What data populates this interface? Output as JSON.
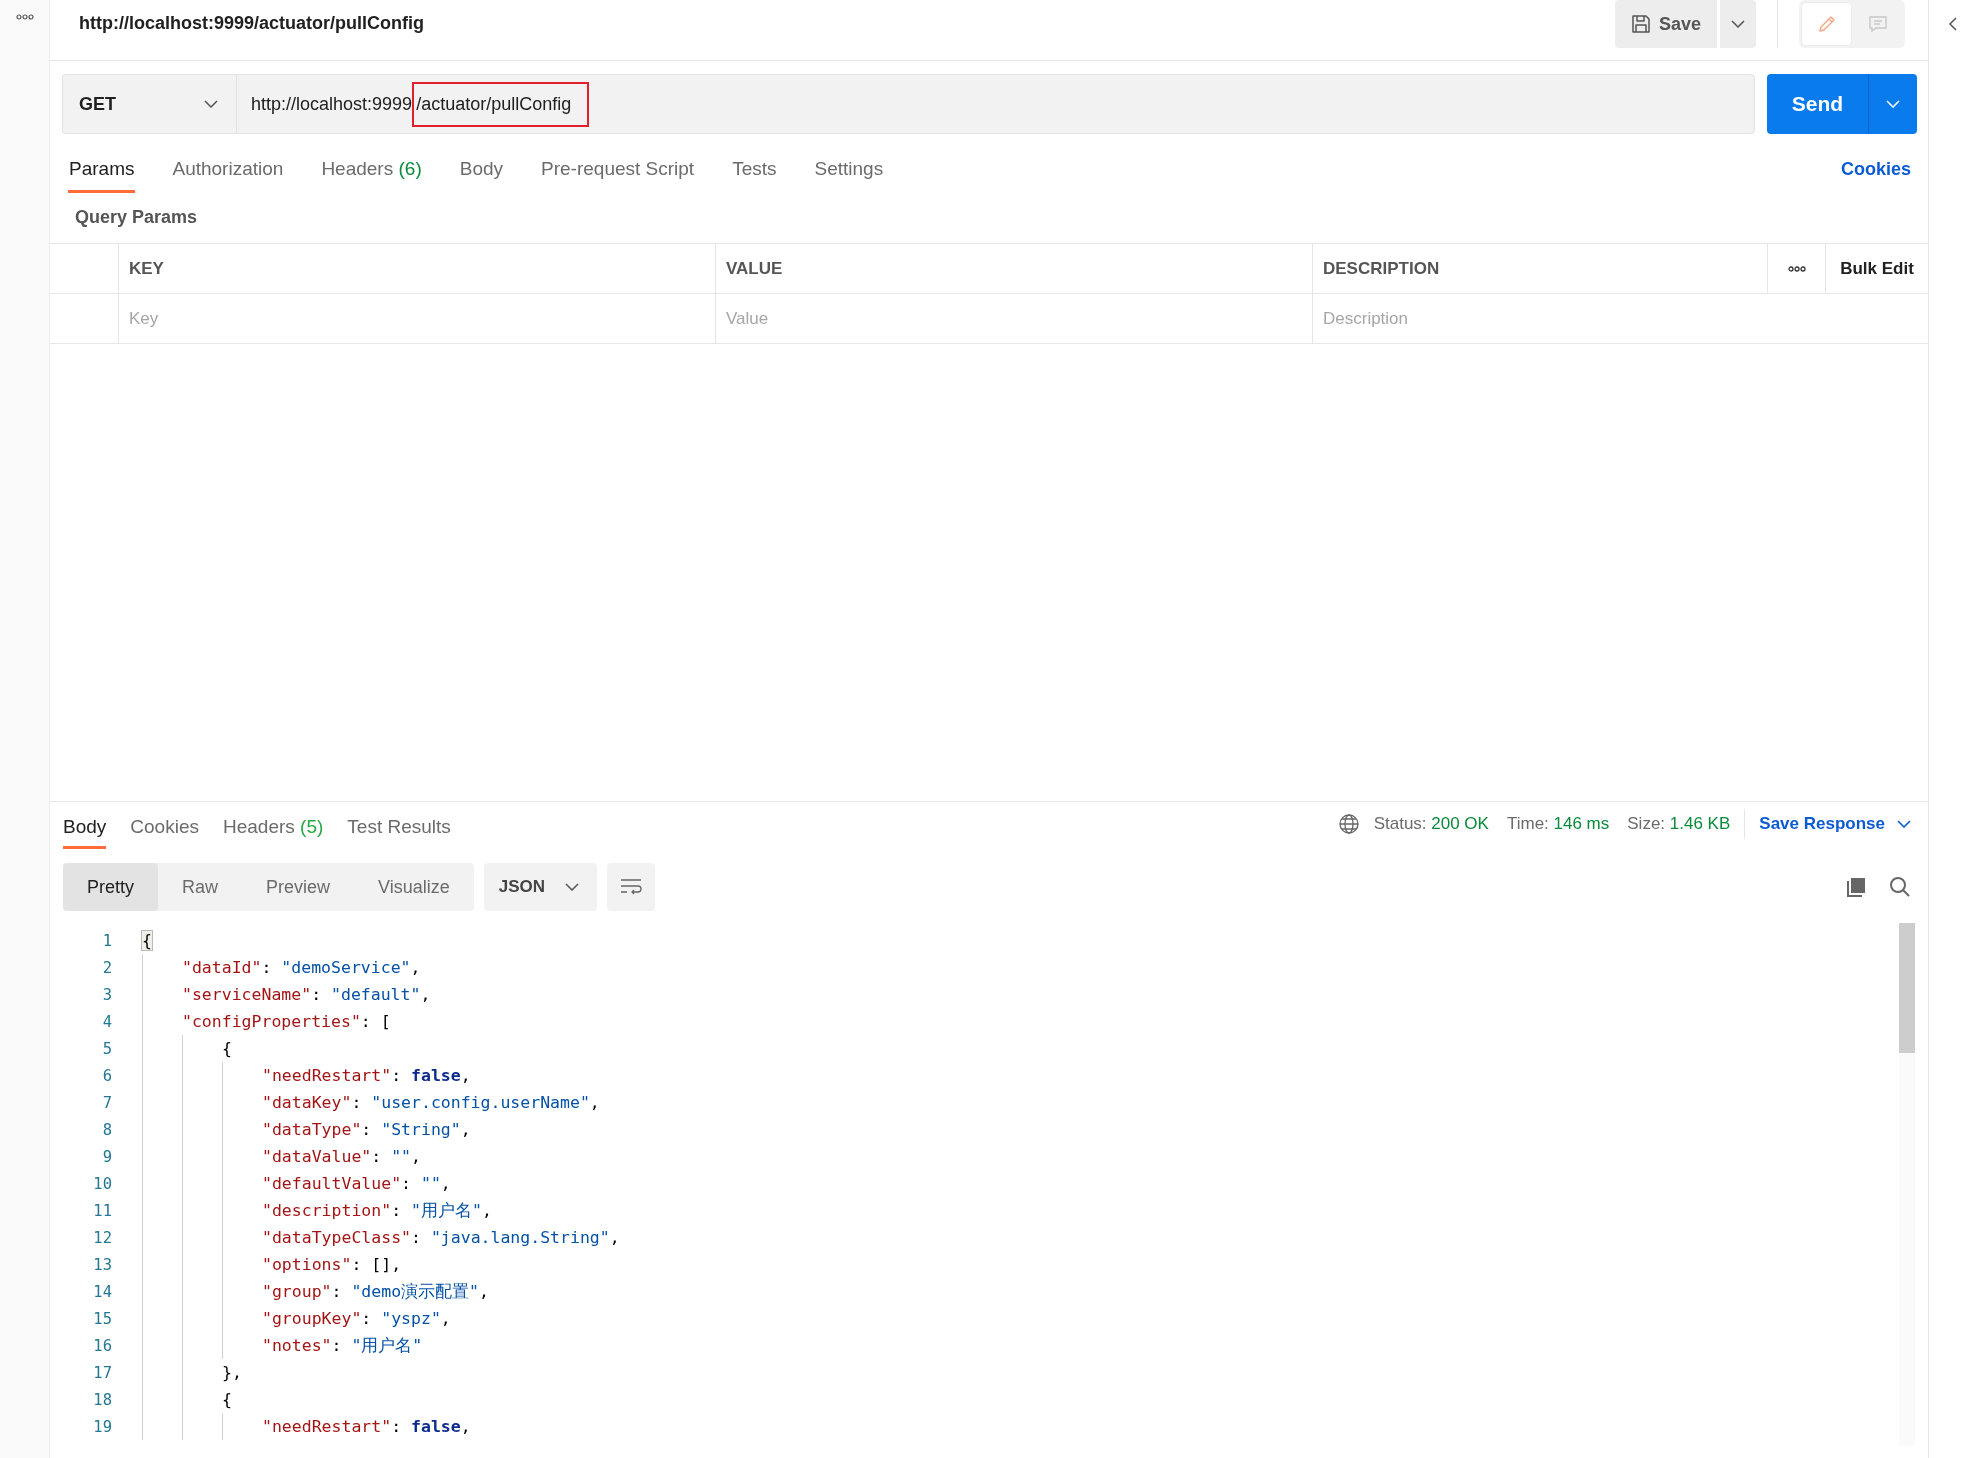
{
  "request_title": "http://localhost:9999/actuator/pullConfig",
  "save_button": {
    "label": "Save"
  },
  "mode_buttons": [
    {
      "kind": "edit",
      "selected": true
    },
    {
      "kind": "comment",
      "selected": false
    }
  ],
  "method": {
    "value": "GET"
  },
  "url_parts": [
    {
      "text": "http://localhost:9999",
      "highlighted": false
    },
    {
      "text": "/actuator/pullConfig",
      "highlighted": true
    }
  ],
  "send_button": {
    "label": "Send"
  },
  "request_tabs": [
    {
      "label": "Params",
      "selected": true
    },
    {
      "label": "Authorization",
      "selected": false
    },
    {
      "label": "Headers",
      "count": "(6)",
      "selected": false
    },
    {
      "label": "Body",
      "selected": false
    },
    {
      "label": "Pre-request Script",
      "selected": false
    },
    {
      "label": "Tests",
      "selected": false
    },
    {
      "label": "Settings",
      "selected": false
    }
  ],
  "cookies_link": "Cookies",
  "query_params": {
    "title": "Query Params",
    "columns": [
      "KEY",
      "VALUE",
      "DESCRIPTION"
    ],
    "bulk_edit": "Bulk Edit",
    "placeholders": [
      "Key",
      "Value",
      "Description"
    ]
  },
  "response_tabs": [
    {
      "label": "Body",
      "selected": true
    },
    {
      "label": "Cookies",
      "selected": false
    },
    {
      "label": "Headers",
      "count": "(5)",
      "selected": false
    },
    {
      "label": "Test Results",
      "selected": false
    }
  ],
  "response_meta": [
    {
      "label": "Status:",
      "value": "200 OK"
    },
    {
      "label": "Time:",
      "value": "146 ms"
    },
    {
      "label": "Size:",
      "value": "1.46 KB"
    }
  ],
  "save_response": "Save Response",
  "view_modes": [
    {
      "label": "Pretty",
      "selected": true
    },
    {
      "label": "Raw",
      "selected": false
    },
    {
      "label": "Preview",
      "selected": false
    },
    {
      "label": "Visualize",
      "selected": false
    }
  ],
  "format": "JSON",
  "code_lines": [
    {
      "number": "1",
      "tokens": [
        {
          "kind": "matched_brace",
          "text": "{"
        }
      ],
      "children": [
        {
          "number": "2",
          "tokens": [
            {
              "kind": "key",
              "text": "\"dataId\""
            },
            {
              "kind": "punct",
              "text": ": "
            },
            {
              "kind": "string",
              "text": "\"demoService\""
            },
            {
              "kind": "punct",
              "text": ","
            }
          ]
        },
        {
          "number": "3",
          "tokens": [
            {
              "kind": "key",
              "text": "\"serviceName\""
            },
            {
              "kind": "punct",
              "text": ": "
            },
            {
              "kind": "string",
              "text": "\"default\""
            },
            {
              "kind": "punct",
              "text": ","
            }
          ]
        },
        {
          "number": "4",
          "tokens": [
            {
              "kind": "key",
              "text": "\"configProperties\""
            },
            {
              "kind": "punct",
              "text": ": ["
            }
          ],
          "children": [
            {
              "number": "5",
              "tokens": [
                {
                  "kind": "punct",
                  "text": "{"
                }
              ],
              "children": [
                {
                  "number": "6",
                  "tokens": [
                    {
                      "kind": "key",
                      "text": "\"needRestart\""
                    },
                    {
                      "kind": "punct",
                      "text": ": "
                    },
                    {
                      "kind": "bool",
                      "text": "false"
                    },
                    {
                      "kind": "punct",
                      "text": ","
                    }
                  ]
                },
                {
                  "number": "7",
                  "tokens": [
                    {
                      "kind": "key",
                      "text": "\"dataKey\""
                    },
                    {
                      "kind": "punct",
                      "text": ": "
                    },
                    {
                      "kind": "string",
                      "text": "\"user.config.userName\""
                    },
                    {
                      "kind": "punct",
                      "text": ","
                    }
                  ]
                },
                {
                  "number": "8",
                  "tokens": [
                    {
                      "kind": "key",
                      "text": "\"dataType\""
                    },
                    {
                      "kind": "punct",
                      "text": ": "
                    },
                    {
                      "kind": "string",
                      "text": "\"String\""
                    },
                    {
                      "kind": "punct",
                      "text": ","
                    }
                  ]
                },
                {
                  "number": "9",
                  "tokens": [
                    {
                      "kind": "key",
                      "text": "\"dataValue\""
                    },
                    {
                      "kind": "punct",
                      "text": ": "
                    },
                    {
                      "kind": "string",
                      "text": "\"\""
                    },
                    {
                      "kind": "punct",
                      "text": ","
                    }
                  ]
                },
                {
                  "number": "10",
                  "tokens": [
                    {
                      "kind": "key",
                      "text": "\"defaultValue\""
                    },
                    {
                      "kind": "punct",
                      "text": ": "
                    },
                    {
                      "kind": "string",
                      "text": "\"\""
                    },
                    {
                      "kind": "punct",
                      "text": ","
                    }
                  ]
                },
                {
                  "number": "11",
                  "tokens": [
                    {
                      "kind": "key",
                      "text": "\"description\""
                    },
                    {
                      "kind": "punct",
                      "text": ": "
                    },
                    {
                      "kind": "string",
                      "text": "\"用户名\""
                    },
                    {
                      "kind": "punct",
                      "text": ","
                    }
                  ]
                },
                {
                  "number": "12",
                  "tokens": [
                    {
                      "kind": "key",
                      "text": "\"dataTypeClass\""
                    },
                    {
                      "kind": "punct",
                      "text": ": "
                    },
                    {
                      "kind": "string",
                      "text": "\"java.lang.String\""
                    },
                    {
                      "kind": "punct",
                      "text": ","
                    }
                  ]
                },
                {
                  "number": "13",
                  "tokens": [
                    {
                      "kind": "key",
                      "text": "\"options\""
                    },
                    {
                      "kind": "punct",
                      "text": ": [],"
                    }
                  ]
                },
                {
                  "number": "14",
                  "tokens": [
                    {
                      "kind": "key",
                      "text": "\"group\""
                    },
                    {
                      "kind": "punct",
                      "text": ": "
                    },
                    {
                      "kind": "string",
                      "text": "\"demo演示配置\""
                    },
                    {
                      "kind": "punct",
                      "text": ","
                    }
                  ]
                },
                {
                  "number": "15",
                  "tokens": [
                    {
                      "kind": "key",
                      "text": "\"groupKey\""
                    },
                    {
                      "kind": "punct",
                      "text": ": "
                    },
                    {
                      "kind": "string",
                      "text": "\"yspz\""
                    },
                    {
                      "kind": "punct",
                      "text": ","
                    }
                  ]
                },
                {
                  "number": "16",
                  "tokens": [
                    {
                      "kind": "key",
                      "text": "\"notes\""
                    },
                    {
                      "kind": "punct",
                      "text": ": "
                    },
                    {
                      "kind": "string",
                      "text": "\"用户名\""
                    }
                  ]
                }
              ]
            },
            {
              "number": "17",
              "tokens": [
                {
                  "kind": "punct",
                  "text": "},"
                }
              ]
            },
            {
              "number": "18",
              "tokens": [
                {
                  "kind": "punct",
                  "text": "{"
                }
              ],
              "children": [
                {
                  "number": "19",
                  "tokens": [
                    {
                      "kind": "key",
                      "text": "\"needRestart\""
                    },
                    {
                      "kind": "punct",
                      "text": ": "
                    },
                    {
                      "kind": "bool",
                      "text": "false"
                    },
                    {
                      "kind": "punct",
                      "text": ","
                    }
                  ]
                }
              ]
            }
          ]
        }
      ]
    }
  ]
}
